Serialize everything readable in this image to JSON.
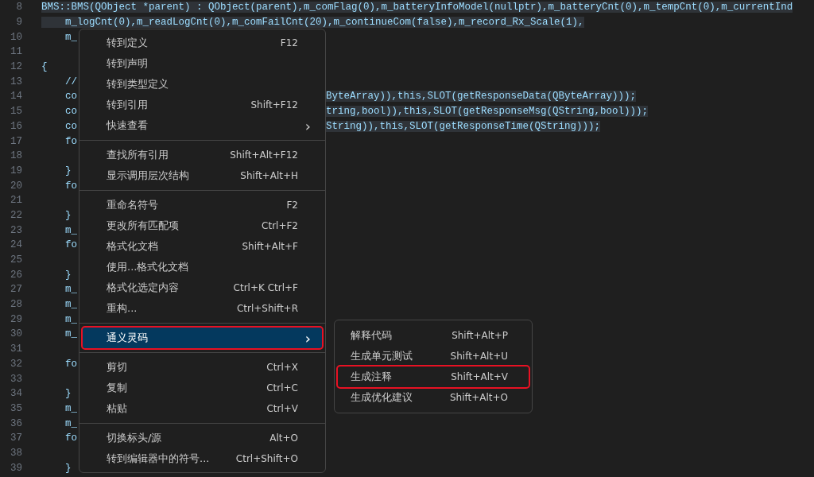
{
  "editor": {
    "lines": [
      {
        "number": "8",
        "full": "BMS::BMS(QObject *parent) : QObject(parent),m_comFlag(0),m_batteryInfoModel(nullptr),m_batteryCnt(0),m_tempCnt(0),m_currentInd"
      },
      {
        "number": "9",
        "full": "    m_logCnt(0),m_readLogCnt(0),m_comFailCnt(20),m_continueCom(false),m_record_Rx_Scale(1),"
      },
      {
        "number": "10",
        "left": "    m_"
      },
      {
        "number": "11"
      },
      {
        "number": "12",
        "left": "{"
      },
      {
        "number": "13",
        "left": "    //"
      },
      {
        "number": "14",
        "left": "    co",
        "right": "ByteArray)),this,SLOT(getResponseData(QByteArray)));"
      },
      {
        "number": "15",
        "left": "    co",
        "right": "tring,bool)),this,SLOT(getResponseMsg(QString,bool)));"
      },
      {
        "number": "16",
        "left": "    co",
        "right": "String)),this,SLOT(getResponseTime(QString)));"
      },
      {
        "number": "17",
        "left": "    fo"
      },
      {
        "number": "18"
      },
      {
        "number": "19",
        "left": "    }"
      },
      {
        "number": "20",
        "left": "    fo"
      },
      {
        "number": "21"
      },
      {
        "number": "22",
        "left": "    }"
      },
      {
        "number": "23",
        "left": "    m_"
      },
      {
        "number": "24",
        "left": "    fo"
      },
      {
        "number": "25"
      },
      {
        "number": "26",
        "left": "    }"
      },
      {
        "number": "27",
        "left": "    m_"
      },
      {
        "number": "28",
        "left": "    m_"
      },
      {
        "number": "29",
        "left": "    m_"
      },
      {
        "number": "30",
        "left": "    m_"
      },
      {
        "number": "31"
      },
      {
        "number": "32",
        "left": "    fo"
      },
      {
        "number": "33"
      },
      {
        "number": "34",
        "left": "    }"
      },
      {
        "number": "35",
        "left": "    m_"
      },
      {
        "number": "36",
        "left": "    m_"
      },
      {
        "number": "37",
        "left": "    fo"
      },
      {
        "number": "38"
      },
      {
        "number": "39",
        "left": "    }"
      }
    ]
  },
  "context_menu": {
    "groups": [
      [
        {
          "label": "转到定义",
          "shortcut": "F12",
          "selected": false,
          "outlined": false
        },
        {
          "label": "转到声明",
          "selected": false,
          "outlined": false
        },
        {
          "label": "转到类型定义",
          "selected": false,
          "outlined": false
        },
        {
          "label": "转到引用",
          "shortcut": "Shift+F12",
          "selected": false,
          "outlined": false
        },
        {
          "label": "快速查看",
          "arrow": "›",
          "selected": false,
          "outlined": false
        }
      ],
      [
        {
          "label": "查找所有引用",
          "shortcut": "Shift+Alt+F12",
          "selected": false,
          "outlined": false
        },
        {
          "label": "显示调用层次结构",
          "shortcut": "Shift+Alt+H",
          "selected": false,
          "outlined": false
        }
      ],
      [
        {
          "label": "重命名符号",
          "shortcut": "F2",
          "selected": false,
          "outlined": false
        },
        {
          "label": "更改所有匹配项",
          "shortcut": "Ctrl+F2",
          "selected": false,
          "outlined": false
        },
        {
          "label": "格式化文档",
          "shortcut": "Shift+Alt+F",
          "selected": false,
          "outlined": false
        },
        {
          "label": "使用...格式化文档",
          "selected": false,
          "outlined": false
        },
        {
          "label": "格式化选定内容",
          "shortcut": "Ctrl+K Ctrl+F",
          "selected": false,
          "outlined": false
        },
        {
          "label": "重构...",
          "shortcut": "Ctrl+Shift+R",
          "selected": false,
          "outlined": false
        }
      ],
      [
        {
          "label": "通义灵码",
          "arrow": "›",
          "selected": true,
          "outlined": true
        }
      ],
      [
        {
          "label": "剪切",
          "shortcut": "Ctrl+X",
          "selected": false,
          "outlined": false
        },
        {
          "label": "复制",
          "shortcut": "Ctrl+C",
          "selected": false,
          "outlined": false
        },
        {
          "label": "粘贴",
          "shortcut": "Ctrl+V",
          "selected": false,
          "outlined": false
        }
      ],
      [
        {
          "label": "切换标头/源",
          "shortcut": "Alt+O",
          "selected": false,
          "outlined": false
        },
        {
          "label": "转到编辑器中的符号...",
          "shortcut": "Ctrl+Shift+O",
          "selected": false,
          "outlined": false
        }
      ]
    ]
  },
  "submenu": {
    "items": [
      {
        "label": "解释代码",
        "shortcut": "Shift+Alt+P",
        "selected": false,
        "outlined": false
      },
      {
        "label": "生成单元测试",
        "shortcut": "Shift+Alt+U",
        "selected": false,
        "outlined": false
      },
      {
        "label": "生成注释",
        "shortcut": "Shift+Alt+V",
        "selected": false,
        "outlined": true
      },
      {
        "label": "生成优化建议",
        "shortcut": "Shift+Alt+O",
        "selected": false,
        "outlined": false
      }
    ]
  }
}
